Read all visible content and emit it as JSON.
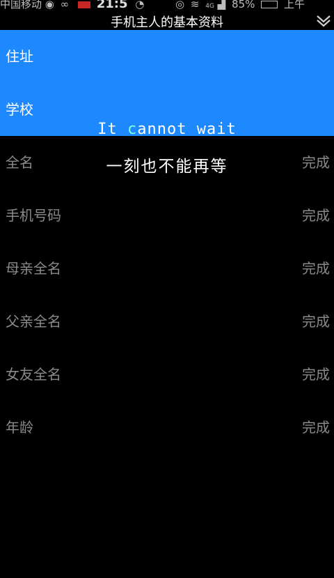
{
  "status_bar": {
    "carrier": "中国移动",
    "time": "21:5",
    "network": "4G",
    "battery": "85%",
    "period": "上午"
  },
  "header": {
    "title": "手机主人的基本资料",
    "menu_icon": "chevron-down-icon"
  },
  "rows": [
    {
      "label": "住址",
      "status": ""
    },
    {
      "label": "学校",
      "status": ""
    },
    {
      "label": "全名",
      "status": "完成"
    },
    {
      "label": "手机号码",
      "status": "完成"
    },
    {
      "label": "母亲全名",
      "status": "完成"
    },
    {
      "label": "父亲全名",
      "status": "完成"
    },
    {
      "label": "女友全名",
      "status": "完成"
    },
    {
      "label": "年龄",
      "status": "完成"
    }
  ],
  "overlay": {
    "en_prefix": "It ",
    "en_highlight": "c",
    "en_suffix": "annot wait",
    "cn": "一刻也不能再等"
  },
  "colors": {
    "active_row": "#1e88ff",
    "background": "#000000",
    "muted_text": "#8a8a8a",
    "highlight_letter": "#7fffd4"
  }
}
